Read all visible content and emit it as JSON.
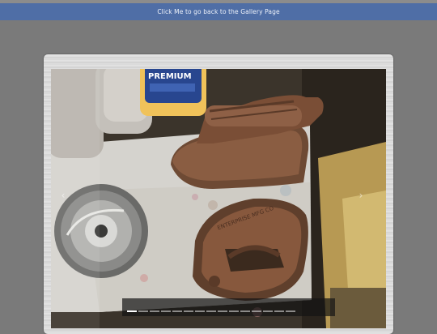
{
  "header": {
    "gallery_link_label": "Click Me to go back to the Gallery Page"
  },
  "colors": {
    "page_background": "#7a7a7a",
    "header_bar": "#4f6ea6",
    "link_text": "#eef2fa"
  },
  "slideshow": {
    "image_label": "Photo of cast iron sad irons on a workbench",
    "can_label": "PREMIUM",
    "iron_casting_text": "ENTERPRISE MFG CO",
    "prev_icon": "chevron-left-icon",
    "next_icon": "chevron-right-icon",
    "page_count": 15,
    "current_page": 1
  }
}
